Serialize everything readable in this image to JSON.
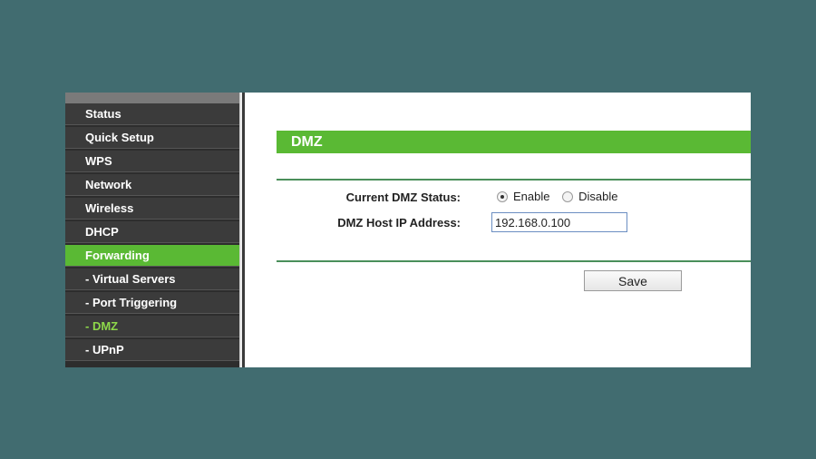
{
  "sidebar": {
    "items": [
      {
        "label": "Status",
        "state": "normal"
      },
      {
        "label": "Quick Setup",
        "state": "normal"
      },
      {
        "label": "WPS",
        "state": "normal"
      },
      {
        "label": "Network",
        "state": "normal"
      },
      {
        "label": "Wireless",
        "state": "normal"
      },
      {
        "label": "DHCP",
        "state": "normal"
      },
      {
        "label": "Forwarding",
        "state": "active"
      },
      {
        "label": "- Virtual Servers",
        "state": "normal"
      },
      {
        "label": "- Port Triggering",
        "state": "normal"
      },
      {
        "label": "- DMZ",
        "state": "selected-sub"
      },
      {
        "label": "- UPnP",
        "state": "normal"
      }
    ]
  },
  "main": {
    "title": "DMZ",
    "status_label": "Current DMZ Status:",
    "enable_label": "Enable",
    "disable_label": "Disable",
    "status_value": "Enable",
    "ip_label": "DMZ Host IP Address:",
    "ip_value": "192.168.0.100",
    "save_label": "Save"
  },
  "colors": {
    "accent": "#5ab934",
    "background": "#416c70",
    "sidebar": "#3b3b3b"
  }
}
